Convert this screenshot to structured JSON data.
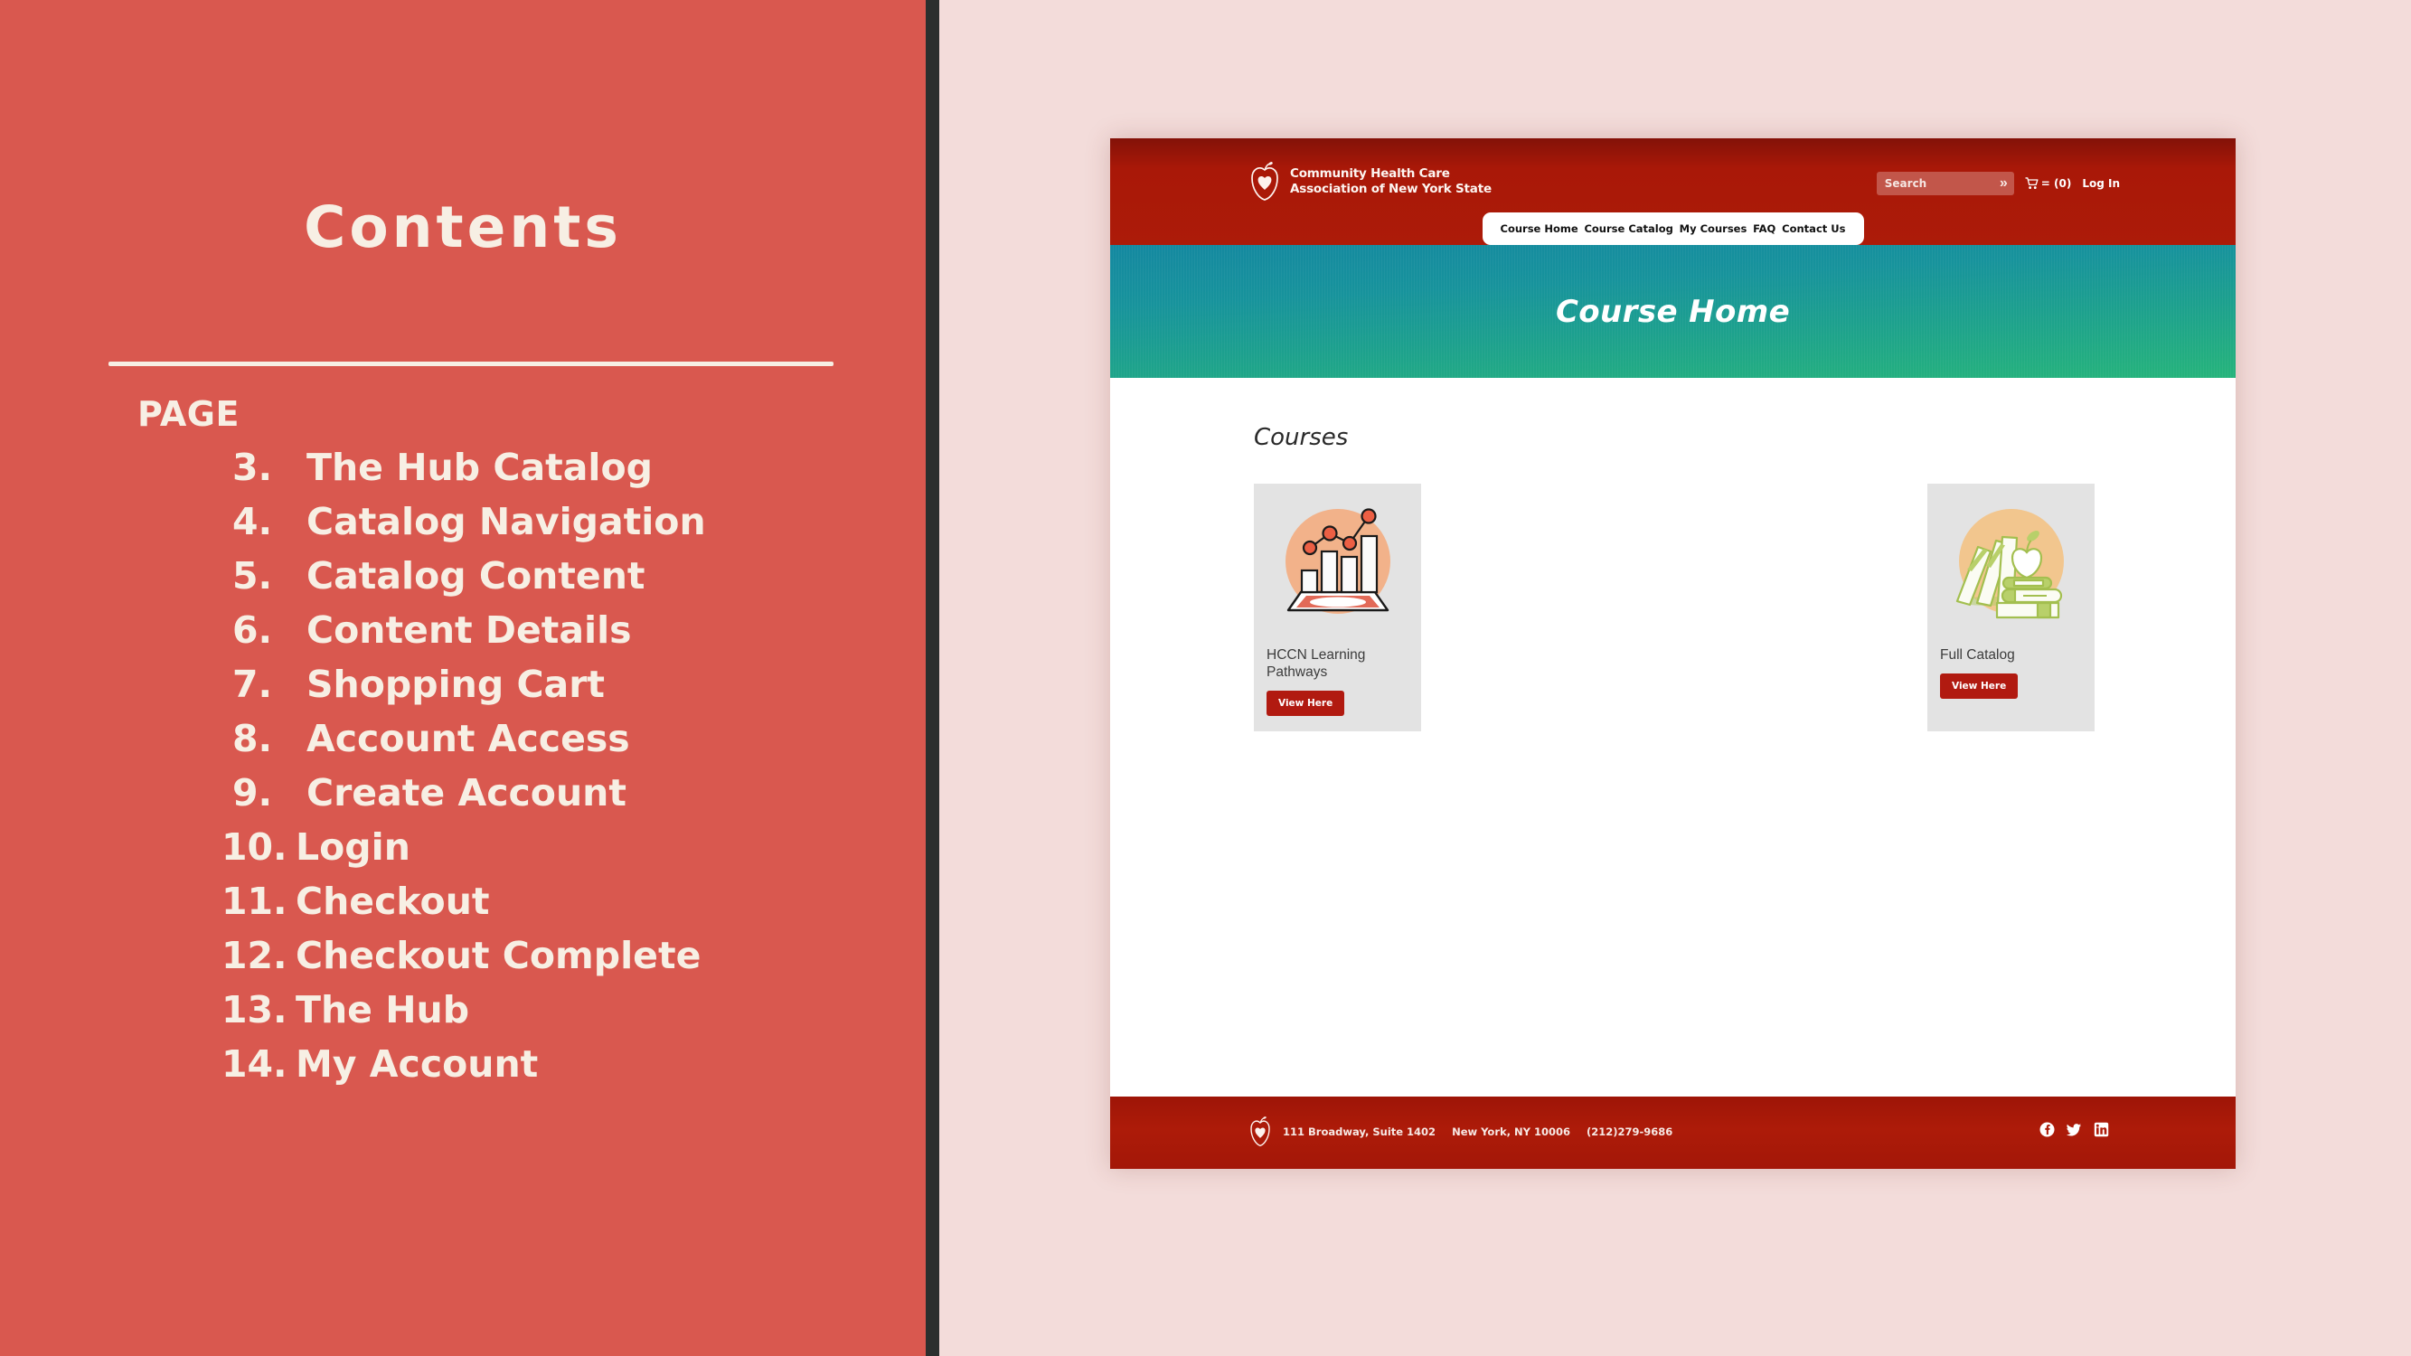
{
  "slide": {
    "title": "Contents",
    "page_label": "PAGE",
    "toc": [
      {
        "num": "3.",
        "label": "The Hub Catalog"
      },
      {
        "num": "4.",
        "label": "Catalog Navigation"
      },
      {
        "num": "5.",
        "label": "Catalog Content"
      },
      {
        "num": "6.",
        "label": "Content Details"
      },
      {
        "num": "7.",
        "label": "Shopping Cart"
      },
      {
        "num": "8.",
        "label": "Account Access"
      },
      {
        "num": "9.",
        "label": "Create Account"
      },
      {
        "num": "10.",
        "label": "Login"
      },
      {
        "num": "11.",
        "label": "Checkout"
      },
      {
        "num": "12.",
        "label": "Checkout Complete"
      },
      {
        "num": "13.",
        "label": "The Hub"
      },
      {
        "num": "14.",
        "label": "My Account"
      }
    ]
  },
  "colors": {
    "left_panel": "#d9584f",
    "right_panel": "#f3dcda",
    "divider": "#2b2f2e",
    "cream": "#f7efe4",
    "brand_red": "#ac1b09",
    "button_red": "#b11a10",
    "hero_teal": "#1488a0",
    "hero_green": "#26b47b",
    "card_gray": "#e3e3e3"
  },
  "mockup": {
    "header": {
      "brand_line1": "Community Health Care",
      "brand_line2": "Association of New York State",
      "search_placeholder": "Search",
      "search_value": "Search",
      "search_submit": "»",
      "cart_label": "= (0)",
      "login_label": "Log In"
    },
    "nav": [
      {
        "label": "Course Home"
      },
      {
        "label": "Course Catalog"
      },
      {
        "label": "My Courses"
      },
      {
        "label": "FAQ"
      },
      {
        "label": "Contact Us"
      }
    ],
    "hero": {
      "title": "Course Home"
    },
    "body": {
      "section_title": "Courses",
      "cards": [
        {
          "title": "HCCN Learning Pathways",
          "button": "View Here",
          "art": "bar-chart-tablet-illustration"
        },
        {
          "title": "Full Catalog",
          "button": "View Here",
          "art": "books-apple-illustration"
        }
      ]
    },
    "footer": {
      "address": "111 Broadway, Suite 1402",
      "city": "New York, NY 10006",
      "phone": "(212)279-9686",
      "social": [
        {
          "name": "facebook-icon"
        },
        {
          "name": "twitter-icon"
        },
        {
          "name": "linkedin-icon"
        }
      ]
    }
  }
}
